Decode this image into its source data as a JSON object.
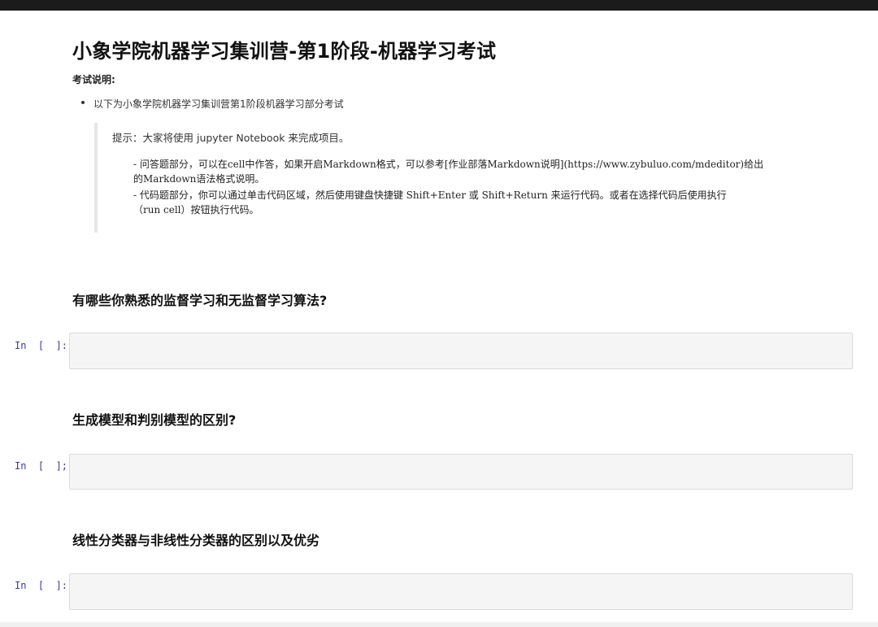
{
  "title": "小象学院机器学习集训营-第1阶段-机器学习考试",
  "exam_label": "考试说明:",
  "bullet": "以下为小象学院机器学习集训营第1阶段机器学习部分考试",
  "hint": {
    "label": "提示：大家将使用 jupyter Notebook 来完成项目。",
    "lines": [
      "- 问答题部分，可以在cell中作答，如果开启Markdown格式，可以参考[作业部落Markdown说明](https://www.zybuluo.com/mdeditor)给出",
      "的Markdown语法格式说明。",
      "- 代码题部分，你可以通过单击代码区域，然后使用键盘快捷键 Shift+Enter 或 Shift+Return 来运行代码。或者在选择代码后使用执行",
      "（run cell）按钮执行代码。"
    ]
  },
  "questions": [
    {
      "heading": "有哪些你熟悉的监督学习和无监督学习算法?",
      "prompt": "In  [  ]:",
      "input_value": ""
    },
    {
      "heading": "生成模型和判别模型的区别?",
      "prompt": "In  [  ];",
      "input_value": ""
    },
    {
      "heading": "线性分类器与非线性分类器的区别以及优劣",
      "prompt": "In  [  ]:",
      "input_value": ""
    }
  ]
}
